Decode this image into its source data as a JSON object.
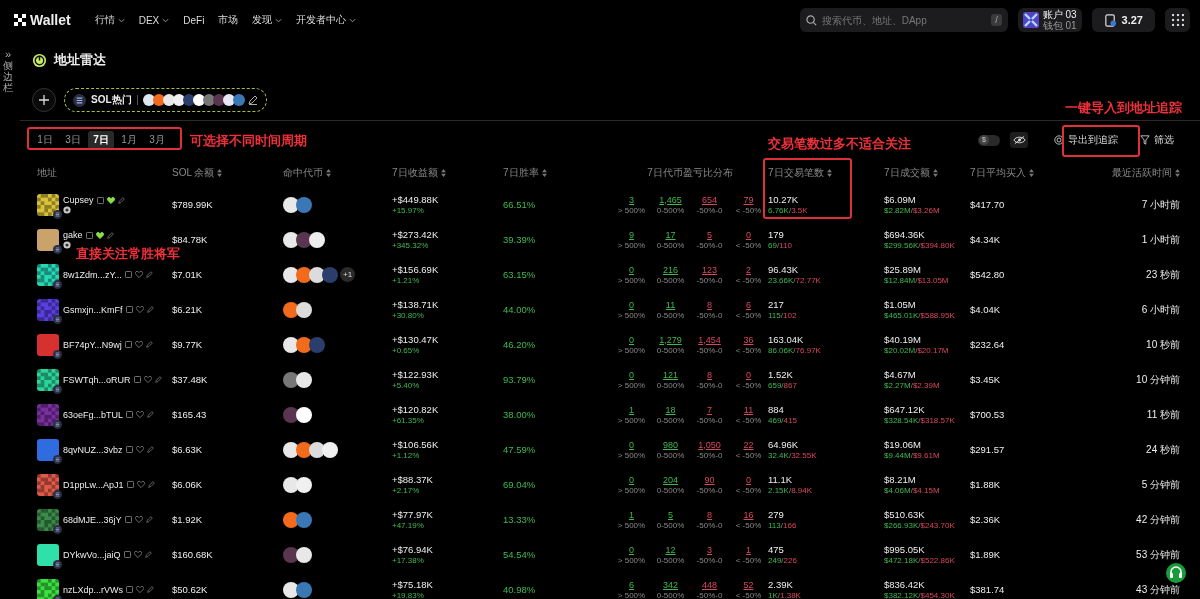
{
  "sidebar": {
    "toggle": "»",
    "label": "侧边栏"
  },
  "nav": {
    "logo": "Wallet",
    "menu": [
      {
        "label": "行情",
        "dropdown": true
      },
      {
        "label": "DEX",
        "dropdown": true
      },
      {
        "label": "DeFi",
        "dropdown": false
      },
      {
        "label": "市场",
        "dropdown": false
      },
      {
        "label": "发现",
        "dropdown": true
      },
      {
        "label": "开发者中心",
        "dropdown": true
      }
    ],
    "search": {
      "placeholder": "搜索代币、地址、DApp",
      "shortcut": "/"
    },
    "account": {
      "name": "账户 03",
      "wallet": "钱包 01"
    },
    "balance": "3.27"
  },
  "page": {
    "title": "地址雷达"
  },
  "group": {
    "name": "SOL热门",
    "tokens": [
      {
        "color": "#dfe6ee"
      },
      {
        "color": "#f26a1b"
      },
      {
        "color": "#e8e8e8"
      },
      {
        "color": "#f0f0f0"
      },
      {
        "color": "#2a3d6b"
      },
      {
        "color": "#ffffff"
      },
      {
        "color": "#777777"
      },
      {
        "color": "#5a3550"
      },
      {
        "color": "#e8e8f4"
      },
      {
        "color": "#3a78b5"
      }
    ]
  },
  "periods": [
    {
      "label": "1日",
      "selected": false
    },
    {
      "label": "3日",
      "selected": false
    },
    {
      "label": "7日",
      "selected": true
    },
    {
      "label": "1月",
      "selected": false
    },
    {
      "label": "3月",
      "selected": false
    }
  ],
  "toolbar": {
    "usd_symbol": "$",
    "usd_on": false,
    "export": "导出到追踪",
    "filter": "筛选"
  },
  "table": {
    "columns": [
      {
        "label": "地址",
        "sortable": false
      },
      {
        "label": "SOL 余额",
        "sortable": true
      },
      {
        "label": "命中代币",
        "sortable": true
      },
      {
        "label": "7日收益额",
        "sortable": true
      },
      {
        "label": "7日胜率",
        "sortable": true
      },
      {
        "label": "7日代币盈亏比分布",
        "sortable": false
      },
      {
        "label": "7日交易笔数",
        "sortable": true
      },
      {
        "label": "7日成交额",
        "sortable": true
      },
      {
        "label": "7日平均买入",
        "sortable": true
      },
      {
        "label": "最近活跃时间",
        "sortable": true
      }
    ],
    "rows": [
      {
        "address": "Cupsey",
        "avatar": {
          "color": "#d9c23a"
        },
        "followed": true,
        "badge": true,
        "balance": "$789.99K",
        "tokens": [
          {
            "color": "#e8e8e8"
          },
          {
            "color": "#3a78b5"
          }
        ],
        "pnl": "+$449.88K",
        "pnl_pct": "+15.97%",
        "winrate": "66.51%",
        "dist": [
          {
            "count": "3",
            "label": "> 500%"
          },
          {
            "count": "1,465",
            "label": "0-500%"
          },
          {
            "count": "654",
            "label": "-50%-0"
          },
          {
            "count": "79",
            "label": "< -50%"
          }
        ],
        "tx": "10.27K",
        "tx_buy": "6.76K",
        "tx_sep": "/",
        "tx_sell": "3.5K",
        "volume": "$6.09M",
        "vol_buy": "$2.82M",
        "vol_sep": "/",
        "vol_sell": "$3.26M",
        "avg_buy": "$417.70",
        "last_active": "7 小时前"
      },
      {
        "address": "gake",
        "avatar": {
          "color": "#c9a36b"
        },
        "followed": true,
        "badge": true,
        "balance": "$84.78K",
        "tokens": [
          {
            "color": "#e8e8e8"
          },
          {
            "color": "#5a3550"
          },
          {
            "color": "#eeeeee"
          }
        ],
        "pnl": "+$273.42K",
        "pnl_pct": "+345.32%",
        "winrate": "39.39%",
        "dist": [
          {
            "count": "9",
            "label": "> 500%"
          },
          {
            "count": "17",
            "label": "0-500%"
          },
          {
            "count": "5",
            "label": "-50%-0"
          },
          {
            "count": "0",
            "label": "< -50%"
          }
        ],
        "tx": "179",
        "tx_buy": "69",
        "tx_sep": "/",
        "tx_sell": "110",
        "volume": "$694.36K",
        "vol_buy": "$299.56K",
        "vol_sep": "/",
        "vol_sell": "$394.80K",
        "avg_buy": "$4.34K",
        "last_active": "1 小时前"
      },
      {
        "address": "8w1Zdm...zY...",
        "avatar": {
          "color": "#27d6b5"
        },
        "followed": false,
        "badge": false,
        "balance": "$7.01K",
        "tokens": [
          {
            "color": "#e8e8e8"
          },
          {
            "color": "#f26a1b"
          },
          {
            "color": "#dcdcdc"
          },
          {
            "color": "#2a3d6b"
          }
        ],
        "more": "+1",
        "pnl": "+$156.69K",
        "pnl_pct": "+1.21%",
        "winrate": "63.15%",
        "dist": [
          {
            "count": "0",
            "label": "> 500%"
          },
          {
            "count": "216",
            "label": "0-500%"
          },
          {
            "count": "123",
            "label": "-50%-0"
          },
          {
            "count": "2",
            "label": "< -50%"
          }
        ],
        "tx": "96.43K",
        "tx_buy": "23.66K",
        "tx_sep": "/",
        "tx_sell": "72.77K",
        "volume": "$25.89M",
        "vol_buy": "$12.84M",
        "vol_sep": "/",
        "vol_sell": "$13.05M",
        "avg_buy": "$542.80",
        "last_active": "23 秒前"
      },
      {
        "address": "Gsmxjn...KmFf",
        "avatar": {
          "color": "#5a3fe0"
        },
        "followed": false,
        "badge": false,
        "balance": "$6.21K",
        "tokens": [
          {
            "color": "#f26a1b"
          },
          {
            "color": "#dcdcdc"
          }
        ],
        "pnl": "+$138.71K",
        "pnl_pct": "+30.80%",
        "winrate": "44.00%",
        "dist": [
          {
            "count": "0",
            "label": "> 500%"
          },
          {
            "count": "11",
            "label": "0-500%"
          },
          {
            "count": "8",
            "label": "-50%-0"
          },
          {
            "count": "6",
            "label": "< -50%"
          }
        ],
        "tx": "217",
        "tx_buy": "115",
        "tx_sep": "/",
        "tx_sell": "102",
        "volume": "$1.05M",
        "vol_buy": "$465.01K",
        "vol_sep": "/",
        "vol_sell": "$588.95K",
        "avg_buy": "$4.04K",
        "last_active": "6 小时前"
      },
      {
        "address": "BF74pY...N9wj",
        "avatar": {
          "color": "#d63030"
        },
        "followed": false,
        "badge": false,
        "balance": "$9.77K",
        "tokens": [
          {
            "color": "#e8e8e8"
          },
          {
            "color": "#f26a1b"
          },
          {
            "color": "#2a3d6b"
          }
        ],
        "pnl": "+$130.47K",
        "pnl_pct": "+0.65%",
        "winrate": "46.20%",
        "dist": [
          {
            "count": "0",
            "label": "> 500%"
          },
          {
            "count": "1,279",
            "label": "0-500%"
          },
          {
            "count": "1,454",
            "label": "-50%-0"
          },
          {
            "count": "36",
            "label": "< -50%"
          }
        ],
        "tx": "163.04K",
        "tx_buy": "86.06K",
        "tx_sep": "/",
        "tx_sell": "76.97K",
        "volume": "$40.19M",
        "vol_buy": "$20.02M",
        "vol_sep": "/",
        "vol_sell": "$20.17M",
        "avg_buy": "$232.64",
        "last_active": "10 秒前"
      },
      {
        "address": "FSWTqh...oRUR",
        "avatar": {
          "color": "#2bd49a"
        },
        "followed": false,
        "badge": false,
        "balance": "$37.48K",
        "tokens": [
          {
            "color": "#777777"
          },
          {
            "color": "#e8e8e8"
          }
        ],
        "pnl": "+$122.93K",
        "pnl_pct": "+5.40%",
        "winrate": "93.79%",
        "dist": [
          {
            "count": "0",
            "label": "> 500%"
          },
          {
            "count": "121",
            "label": "0-500%"
          },
          {
            "count": "8",
            "label": "-50%-0"
          },
          {
            "count": "0",
            "label": "< -50%"
          }
        ],
        "tx": "1.52K",
        "tx_buy": "659",
        "tx_sep": "/",
        "tx_sell": "867",
        "volume": "$4.67M",
        "vol_buy": "$2.27M",
        "vol_sep": "/",
        "vol_sell": "$2.39M",
        "avg_buy": "$3.45K",
        "last_active": "10 分钟前"
      },
      {
        "address": "63oeFg...bTUL",
        "avatar": {
          "color": "#7a2fa0"
        },
        "followed": false,
        "badge": false,
        "balance": "$165.43",
        "tokens": [
          {
            "color": "#5a3550"
          },
          {
            "color": "#ffffff"
          }
        ],
        "pnl": "+$120.82K",
        "pnl_pct": "+61.35%",
        "winrate": "38.00%",
        "dist": [
          {
            "count": "1",
            "label": "> 500%"
          },
          {
            "count": "18",
            "label": "0-500%"
          },
          {
            "count": "7",
            "label": "-50%-0"
          },
          {
            "count": "11",
            "label": "< -50%"
          }
        ],
        "tx": "884",
        "tx_buy": "469",
        "tx_sep": "/",
        "tx_sell": "415",
        "volume": "$647.12K",
        "vol_buy": "$328.54K",
        "vol_sep": "/",
        "vol_sell": "$318.57K",
        "avg_buy": "$700.53",
        "last_active": "11 秒前"
      },
      {
        "address": "8qvNUZ...3vbz",
        "avatar": {
          "color": "#2f6ce0"
        },
        "followed": false,
        "badge": false,
        "balance": "$6.63K",
        "tokens": [
          {
            "color": "#e8e8e8"
          },
          {
            "color": "#f26a1b"
          },
          {
            "color": "#dcdcdc"
          },
          {
            "color": "#f0f0f0"
          }
        ],
        "pnl": "+$106.56K",
        "pnl_pct": "+1.12%",
        "winrate": "47.59%",
        "dist": [
          {
            "count": "0",
            "label": "> 500%"
          },
          {
            "count": "980",
            "label": "0-500%"
          },
          {
            "count": "1,050",
            "label": "-50%-0"
          },
          {
            "count": "22",
            "label": "< -50%"
          }
        ],
        "tx": "64.96K",
        "tx_buy": "32.4K",
        "tx_sep": "/",
        "tx_sell": "32.55K",
        "volume": "$19.06M",
        "vol_buy": "$9.44M",
        "vol_sep": "/",
        "vol_sell": "$9.61M",
        "avg_buy": "$291.57",
        "last_active": "24 秒前"
      },
      {
        "address": "D1ppLw...ApJ1",
        "avatar": {
          "color": "#e05a4a"
        },
        "followed": false,
        "badge": false,
        "balance": "$6.06K",
        "tokens": [
          {
            "color": "#e8e8e8"
          },
          {
            "color": "#f0f0f0"
          }
        ],
        "pnl": "+$88.37K",
        "pnl_pct": "+2.17%",
        "winrate": "69.04%",
        "dist": [
          {
            "count": "0",
            "label": "> 500%"
          },
          {
            "count": "204",
            "label": "0-500%"
          },
          {
            "count": "90",
            "label": "-50%-0"
          },
          {
            "count": "0",
            "label": "< -50%"
          }
        ],
        "tx": "11.1K",
        "tx_buy": "2.15K",
        "tx_sep": "/",
        "tx_sell": "8.94K",
        "volume": "$8.21M",
        "vol_buy": "$4.06M",
        "vol_sep": "/",
        "vol_sell": "$4.15M",
        "avg_buy": "$1.88K",
        "last_active": "5 分钟前"
      },
      {
        "address": "68dMJE...36jY",
        "avatar": {
          "color": "#3a8a4a"
        },
        "followed": false,
        "badge": false,
        "balance": "$1.92K",
        "tokens": [
          {
            "color": "#f26a1b"
          },
          {
            "color": "#3a78b5"
          }
        ],
        "pnl": "+$77.97K",
        "pnl_pct": "+47.19%",
        "winrate": "13.33%",
        "dist": [
          {
            "count": "1",
            "label": "> 500%"
          },
          {
            "count": "5",
            "label": "0-500%"
          },
          {
            "count": "8",
            "label": "-50%-0"
          },
          {
            "count": "16",
            "label": "< -50%"
          }
        ],
        "tx": "279",
        "tx_buy": "113",
        "tx_sep": "/",
        "tx_sell": "166",
        "volume": "$510.63K",
        "vol_buy": "$266.93K",
        "vol_sep": "/",
        "vol_sell": "$243.70K",
        "avg_buy": "$2.36K",
        "last_active": "42 分钟前"
      },
      {
        "address": "DYkwVo...jaiQ",
        "avatar": {
          "color": "#2fe0a8"
        },
        "followed": false,
        "badge": false,
        "balance": "$160.68K",
        "tokens": [
          {
            "color": "#5a3550"
          },
          {
            "color": "#e8e8e8"
          }
        ],
        "pnl": "+$76.94K",
        "pnl_pct": "+17.38%",
        "winrate": "54.54%",
        "dist": [
          {
            "count": "0",
            "label": "> 500%"
          },
          {
            "count": "12",
            "label": "0-500%"
          },
          {
            "count": "3",
            "label": "-50%-0"
          },
          {
            "count": "1",
            "label": "< -50%"
          }
        ],
        "tx": "475",
        "tx_buy": "249",
        "tx_sep": "/",
        "tx_sell": "226",
        "volume": "$995.05K",
        "vol_buy": "$472.18K",
        "vol_sep": "/",
        "vol_sell": "$522.86K",
        "avg_buy": "$1.89K",
        "last_active": "53 分钟前"
      },
      {
        "address": "nzLXdp...rVWs",
        "avatar": {
          "color": "#3ae040"
        },
        "followed": false,
        "badge": false,
        "balance": "$50.62K",
        "tokens": [
          {
            "color": "#e8e8e8"
          },
          {
            "color": "#3a78b5"
          }
        ],
        "pnl": "+$75.18K",
        "pnl_pct": "+19.83%",
        "winrate": "40.98%",
        "dist": [
          {
            "count": "6",
            "label": "> 500%"
          },
          {
            "count": "342",
            "label": "0-500%"
          },
          {
            "count": "448",
            "label": "-50%-0"
          },
          {
            "count": "52",
            "label": "< -50%"
          }
        ],
        "tx": "2.39K",
        "tx_buy": "1K",
        "tx_sep": "/",
        "tx_sell": "1.38K",
        "volume": "$836.42K",
        "vol_buy": "$382.12K",
        "vol_sep": "/",
        "vol_sell": "$454.30K",
        "avg_buy": "$381.74",
        "last_active": "43 分钟前"
      }
    ]
  },
  "annotations": [
    {
      "text": "可选择不同时间周期"
    },
    {
      "text": "交易笔数过多不适合关注"
    },
    {
      "text": "一键导入到地址追踪"
    },
    {
      "text": "直接关注常胜将军"
    }
  ]
}
